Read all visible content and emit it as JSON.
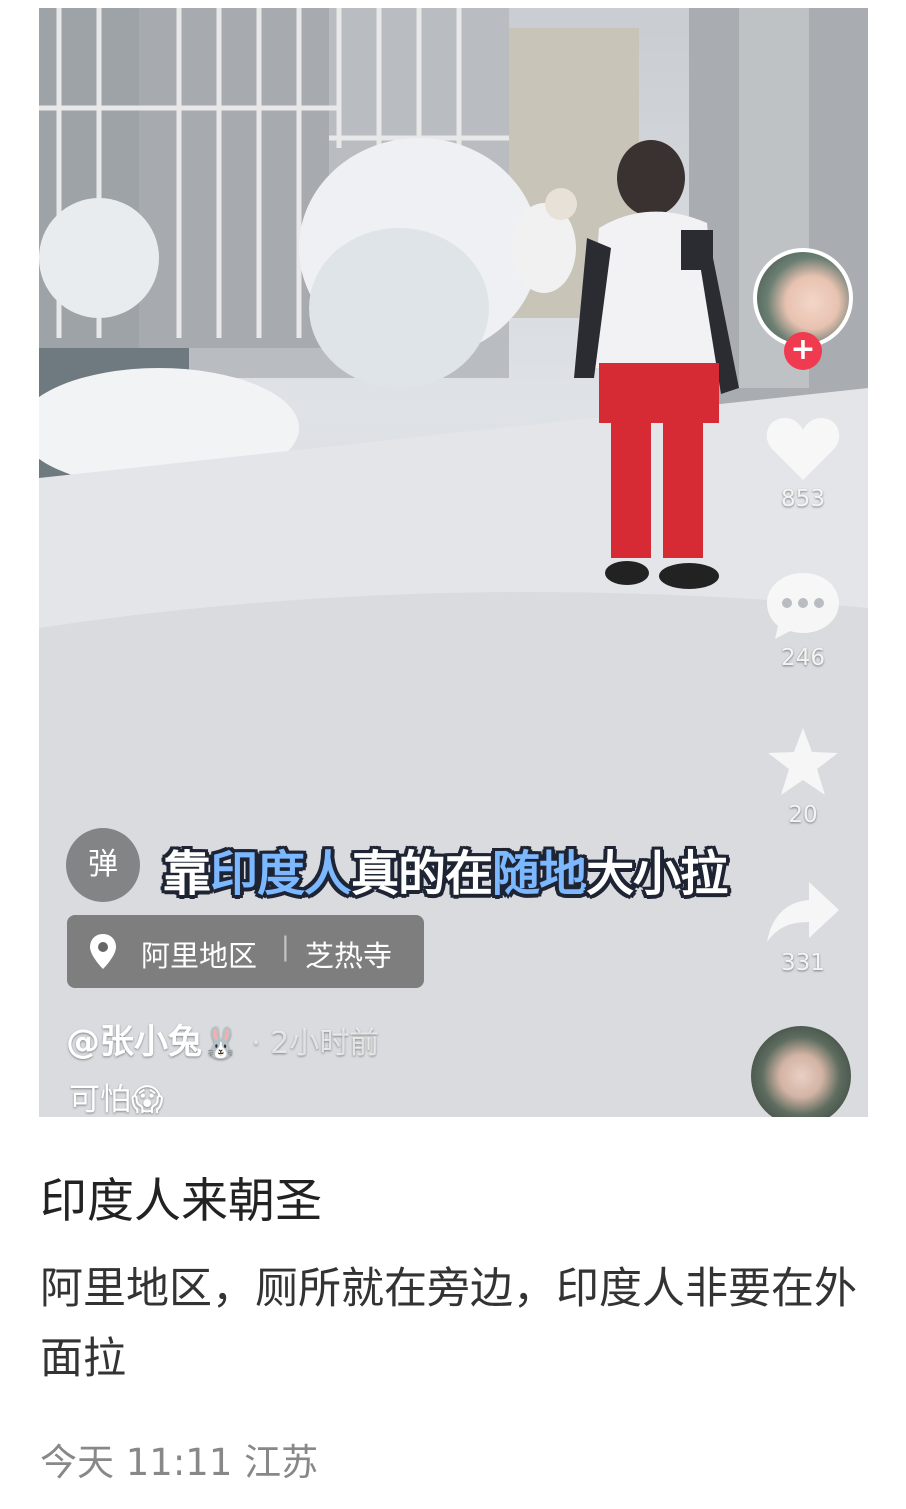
{
  "video": {
    "caption": {
      "segments": [
        {
          "text": "靠",
          "color": "#ffffff"
        },
        {
          "text": "印度人",
          "color": "#7cb8ff"
        },
        {
          "text": "真的在",
          "color": "#ffffff"
        },
        {
          "text": "随地",
          "color": "#7cb8ff"
        },
        {
          "text": "大小拉",
          "color": "#ffffff"
        }
      ]
    },
    "danmu_label": "弹",
    "location": {
      "region": "阿里地区",
      "separator": "|",
      "place": "芝热寺"
    },
    "author": {
      "handle": "@张小兔",
      "emoji": "🐰",
      "time_ago": "· 2小时前"
    },
    "description": {
      "text": "可怕",
      "emoji": "😱"
    },
    "actions": {
      "follow_label": "+",
      "likes": "853",
      "comments": "246",
      "favorites": "20",
      "shares": "331"
    },
    "icons": [
      "heart-icon",
      "comment-icon",
      "star-icon",
      "share-icon",
      "location-pin-icon",
      "follow-plus-icon"
    ]
  },
  "post": {
    "title": "印度人来朝圣",
    "body": "阿里地区，厕所就在旁边，印度人非要在外面拉",
    "meta": "今天 11:11 江苏"
  },
  "colors": {
    "background": "#ffffff",
    "accent_red": "#f03a4f",
    "caption_highlight": "#7cb8ff",
    "caption_outline": "#1e2433"
  }
}
